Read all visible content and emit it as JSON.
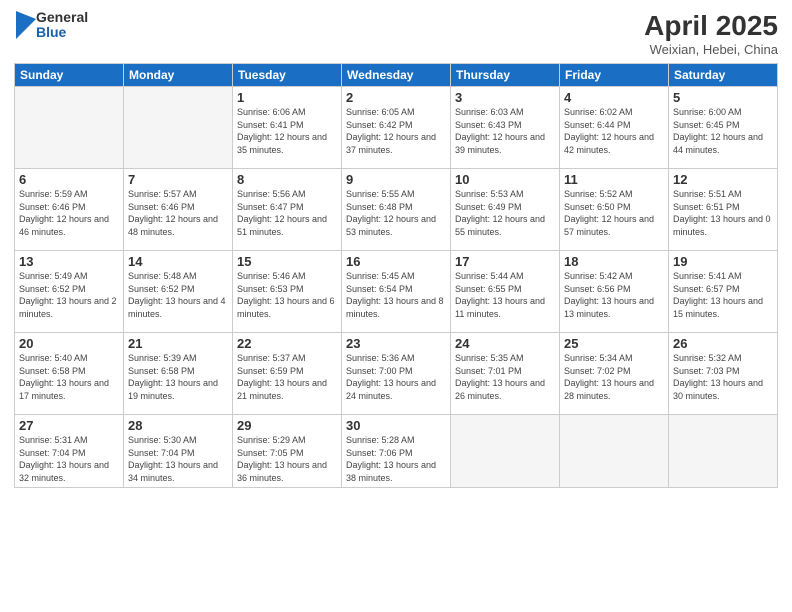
{
  "logo": {
    "general": "General",
    "blue": "Blue"
  },
  "header": {
    "title": "April 2025",
    "location": "Weixian, Hebei, China"
  },
  "days_of_week": [
    "Sunday",
    "Monday",
    "Tuesday",
    "Wednesday",
    "Thursday",
    "Friday",
    "Saturday"
  ],
  "weeks": [
    [
      {
        "day": "",
        "sunrise": "",
        "sunset": "",
        "daylight": ""
      },
      {
        "day": "",
        "sunrise": "",
        "sunset": "",
        "daylight": ""
      },
      {
        "day": "1",
        "sunrise": "Sunrise: 6:06 AM",
        "sunset": "Sunset: 6:41 PM",
        "daylight": "Daylight: 12 hours and 35 minutes."
      },
      {
        "day": "2",
        "sunrise": "Sunrise: 6:05 AM",
        "sunset": "Sunset: 6:42 PM",
        "daylight": "Daylight: 12 hours and 37 minutes."
      },
      {
        "day": "3",
        "sunrise": "Sunrise: 6:03 AM",
        "sunset": "Sunset: 6:43 PM",
        "daylight": "Daylight: 12 hours and 39 minutes."
      },
      {
        "day": "4",
        "sunrise": "Sunrise: 6:02 AM",
        "sunset": "Sunset: 6:44 PM",
        "daylight": "Daylight: 12 hours and 42 minutes."
      },
      {
        "day": "5",
        "sunrise": "Sunrise: 6:00 AM",
        "sunset": "Sunset: 6:45 PM",
        "daylight": "Daylight: 12 hours and 44 minutes."
      }
    ],
    [
      {
        "day": "6",
        "sunrise": "Sunrise: 5:59 AM",
        "sunset": "Sunset: 6:46 PM",
        "daylight": "Daylight: 12 hours and 46 minutes."
      },
      {
        "day": "7",
        "sunrise": "Sunrise: 5:57 AM",
        "sunset": "Sunset: 6:46 PM",
        "daylight": "Daylight: 12 hours and 48 minutes."
      },
      {
        "day": "8",
        "sunrise": "Sunrise: 5:56 AM",
        "sunset": "Sunset: 6:47 PM",
        "daylight": "Daylight: 12 hours and 51 minutes."
      },
      {
        "day": "9",
        "sunrise": "Sunrise: 5:55 AM",
        "sunset": "Sunset: 6:48 PM",
        "daylight": "Daylight: 12 hours and 53 minutes."
      },
      {
        "day": "10",
        "sunrise": "Sunrise: 5:53 AM",
        "sunset": "Sunset: 6:49 PM",
        "daylight": "Daylight: 12 hours and 55 minutes."
      },
      {
        "day": "11",
        "sunrise": "Sunrise: 5:52 AM",
        "sunset": "Sunset: 6:50 PM",
        "daylight": "Daylight: 12 hours and 57 minutes."
      },
      {
        "day": "12",
        "sunrise": "Sunrise: 5:51 AM",
        "sunset": "Sunset: 6:51 PM",
        "daylight": "Daylight: 13 hours and 0 minutes."
      }
    ],
    [
      {
        "day": "13",
        "sunrise": "Sunrise: 5:49 AM",
        "sunset": "Sunset: 6:52 PM",
        "daylight": "Daylight: 13 hours and 2 minutes."
      },
      {
        "day": "14",
        "sunrise": "Sunrise: 5:48 AM",
        "sunset": "Sunset: 6:52 PM",
        "daylight": "Daylight: 13 hours and 4 minutes."
      },
      {
        "day": "15",
        "sunrise": "Sunrise: 5:46 AM",
        "sunset": "Sunset: 6:53 PM",
        "daylight": "Daylight: 13 hours and 6 minutes."
      },
      {
        "day": "16",
        "sunrise": "Sunrise: 5:45 AM",
        "sunset": "Sunset: 6:54 PM",
        "daylight": "Daylight: 13 hours and 8 minutes."
      },
      {
        "day": "17",
        "sunrise": "Sunrise: 5:44 AM",
        "sunset": "Sunset: 6:55 PM",
        "daylight": "Daylight: 13 hours and 11 minutes."
      },
      {
        "day": "18",
        "sunrise": "Sunrise: 5:42 AM",
        "sunset": "Sunset: 6:56 PM",
        "daylight": "Daylight: 13 hours and 13 minutes."
      },
      {
        "day": "19",
        "sunrise": "Sunrise: 5:41 AM",
        "sunset": "Sunset: 6:57 PM",
        "daylight": "Daylight: 13 hours and 15 minutes."
      }
    ],
    [
      {
        "day": "20",
        "sunrise": "Sunrise: 5:40 AM",
        "sunset": "Sunset: 6:58 PM",
        "daylight": "Daylight: 13 hours and 17 minutes."
      },
      {
        "day": "21",
        "sunrise": "Sunrise: 5:39 AM",
        "sunset": "Sunset: 6:58 PM",
        "daylight": "Daylight: 13 hours and 19 minutes."
      },
      {
        "day": "22",
        "sunrise": "Sunrise: 5:37 AM",
        "sunset": "Sunset: 6:59 PM",
        "daylight": "Daylight: 13 hours and 21 minutes."
      },
      {
        "day": "23",
        "sunrise": "Sunrise: 5:36 AM",
        "sunset": "Sunset: 7:00 PM",
        "daylight": "Daylight: 13 hours and 24 minutes."
      },
      {
        "day": "24",
        "sunrise": "Sunrise: 5:35 AM",
        "sunset": "Sunset: 7:01 PM",
        "daylight": "Daylight: 13 hours and 26 minutes."
      },
      {
        "day": "25",
        "sunrise": "Sunrise: 5:34 AM",
        "sunset": "Sunset: 7:02 PM",
        "daylight": "Daylight: 13 hours and 28 minutes."
      },
      {
        "day": "26",
        "sunrise": "Sunrise: 5:32 AM",
        "sunset": "Sunset: 7:03 PM",
        "daylight": "Daylight: 13 hours and 30 minutes."
      }
    ],
    [
      {
        "day": "27",
        "sunrise": "Sunrise: 5:31 AM",
        "sunset": "Sunset: 7:04 PM",
        "daylight": "Daylight: 13 hours and 32 minutes."
      },
      {
        "day": "28",
        "sunrise": "Sunrise: 5:30 AM",
        "sunset": "Sunset: 7:04 PM",
        "daylight": "Daylight: 13 hours and 34 minutes."
      },
      {
        "day": "29",
        "sunrise": "Sunrise: 5:29 AM",
        "sunset": "Sunset: 7:05 PM",
        "daylight": "Daylight: 13 hours and 36 minutes."
      },
      {
        "day": "30",
        "sunrise": "Sunrise: 5:28 AM",
        "sunset": "Sunset: 7:06 PM",
        "daylight": "Daylight: 13 hours and 38 minutes."
      },
      {
        "day": "",
        "sunrise": "",
        "sunset": "",
        "daylight": ""
      },
      {
        "day": "",
        "sunrise": "",
        "sunset": "",
        "daylight": ""
      },
      {
        "day": "",
        "sunrise": "",
        "sunset": "",
        "daylight": ""
      }
    ]
  ]
}
